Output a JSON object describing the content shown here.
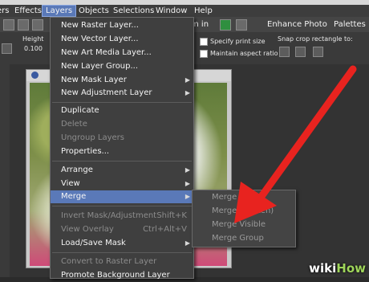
{
  "menubar": {
    "items": [
      "ers",
      "Effects",
      "Layers",
      "Objects",
      "Selections",
      "Window",
      "Help"
    ]
  },
  "toolbar": {
    "zoom_text": "m in",
    "enhance": "Enhance Photo",
    "palettes": "Palettes"
  },
  "options": {
    "height_label": "Height",
    "height_value": "0.100",
    "specify_print": "Specify print size",
    "maintain_aspect": "Maintain aspect ratio",
    "snap_label": "Snap crop rectangle to:"
  },
  "layers_menu": {
    "items": [
      {
        "label": "New Raster Layer...",
        "disabled": false,
        "submenu": false,
        "shortcut": ""
      },
      {
        "label": "New Vector Layer...",
        "disabled": false,
        "submenu": false,
        "shortcut": ""
      },
      {
        "label": "New Art Media Layer...",
        "disabled": false,
        "submenu": false,
        "shortcut": ""
      },
      {
        "label": "New Layer Group...",
        "disabled": false,
        "submenu": false,
        "shortcut": ""
      },
      {
        "label": "New Mask Layer",
        "disabled": false,
        "submenu": true,
        "shortcut": ""
      },
      {
        "label": "New Adjustment Layer",
        "disabled": false,
        "submenu": true,
        "shortcut": ""
      },
      {
        "label": "Duplicate",
        "disabled": false,
        "submenu": false,
        "shortcut": ""
      },
      {
        "label": "Delete",
        "disabled": true,
        "submenu": false,
        "shortcut": ""
      },
      {
        "label": "Ungroup Layers",
        "disabled": true,
        "submenu": false,
        "shortcut": ""
      },
      {
        "label": "Properties...",
        "disabled": false,
        "submenu": false,
        "shortcut": ""
      },
      {
        "label": "Arrange",
        "disabled": false,
        "submenu": true,
        "shortcut": ""
      },
      {
        "label": "View",
        "disabled": false,
        "submenu": true,
        "shortcut": ""
      },
      {
        "label": "Merge",
        "disabled": false,
        "submenu": true,
        "shortcut": ""
      },
      {
        "label": "Invert Mask/Adjustment",
        "disabled": true,
        "submenu": false,
        "shortcut": "Shift+K"
      },
      {
        "label": "View Overlay",
        "disabled": true,
        "submenu": false,
        "shortcut": "Ctrl+Alt+V"
      },
      {
        "label": "Load/Save Mask",
        "disabled": false,
        "submenu": true,
        "shortcut": ""
      },
      {
        "label": "Convert to Raster Layer",
        "disabled": true,
        "submenu": false,
        "shortcut": ""
      },
      {
        "label": "Promote Background Layer",
        "disabled": false,
        "submenu": false,
        "shortcut": ""
      }
    ]
  },
  "merge_submenu": {
    "items": [
      "Merge D",
      "Merge (Flatten)",
      "Merge Visible",
      "Merge Group"
    ]
  },
  "watermark": {
    "wiki": "wiki",
    "how": "How"
  },
  "colors": {
    "highlight": "#5a79b8",
    "arrow": "#e8231f",
    "brand_green": "#9fd55a"
  }
}
